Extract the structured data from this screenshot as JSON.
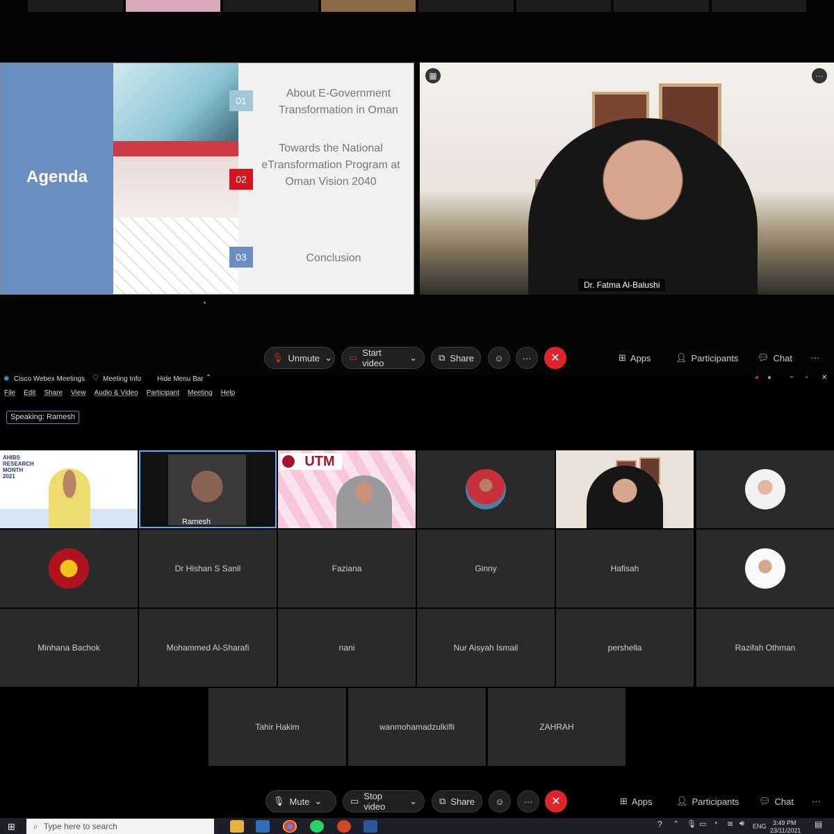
{
  "shared_slide": {
    "title": "Agenda",
    "items": [
      {
        "num": "01",
        "text": "About E-Government Transformation in Oman"
      },
      {
        "num": "02",
        "text": "Towards the National eTransformation Program at Oman Vision 2040"
      },
      {
        "num": "03",
        "text": "Conclusion"
      }
    ]
  },
  "speaker": {
    "name": "Dr. Fatma Al-Balushi"
  },
  "top_controls": {
    "unmute": "Unmute",
    "start_video": "Start video",
    "share": "Share",
    "apps": "Apps",
    "participants": "Participants",
    "chat": "Chat",
    "more": "···"
  },
  "webex": {
    "app_title": "Cisco Webex Meetings",
    "meeting_info": "Meeting Info",
    "hide_menu_bar": "Hide Menu Bar",
    "menu": [
      "File",
      "Edit",
      "Share",
      "View",
      "Audio & Video",
      "Participant",
      "Meeting",
      "Help"
    ],
    "speaking_label": "Speaking:",
    "speaking_name": "Ramesh"
  },
  "thumb_texts": {
    "ahibs": "AHIBS RESEARCH MONTH 2021",
    "utm": "UTM"
  },
  "participants": {
    "video_tiles": [
      {
        "name": "",
        "kind": "ahibs"
      },
      {
        "name": "Ramesh",
        "kind": "ramesh"
      },
      {
        "name": "",
        "kind": "utm"
      },
      {
        "name": "",
        "kind": "avatar"
      },
      {
        "name": "",
        "kind": "speaker"
      },
      {
        "name": "",
        "kind": "avatar"
      }
    ],
    "row2": [
      "",
      "Dr Hishan S Sanil",
      "Faziana",
      "Ginny",
      "Hafisah",
      ""
    ],
    "row3": [
      "Minhana Bachok",
      "Mohammed Al-Sharafi",
      "nani",
      "Nur Aisyah Ismail",
      "pershella",
      "Razifah Othman"
    ],
    "row4": [
      "Tahir Hakim",
      "wanmohamadzulkifli",
      "ZAHRAH"
    ]
  },
  "bottom_controls": {
    "mute": "Mute",
    "stop_video": "Stop video",
    "share": "Share",
    "apps": "Apps",
    "participants": "Participants",
    "chat": "Chat",
    "more": "···"
  },
  "taskbar": {
    "search_placeholder": "Type here to search",
    "language": "ENG",
    "time": "3:49 PM",
    "date": "23/11/2021"
  },
  "colors": {
    "slide_blue": "#6b8ec0",
    "slide_red": "#d3151f",
    "end_call_red": "#e0242c",
    "active_speaker_border": "#5db3ff"
  }
}
